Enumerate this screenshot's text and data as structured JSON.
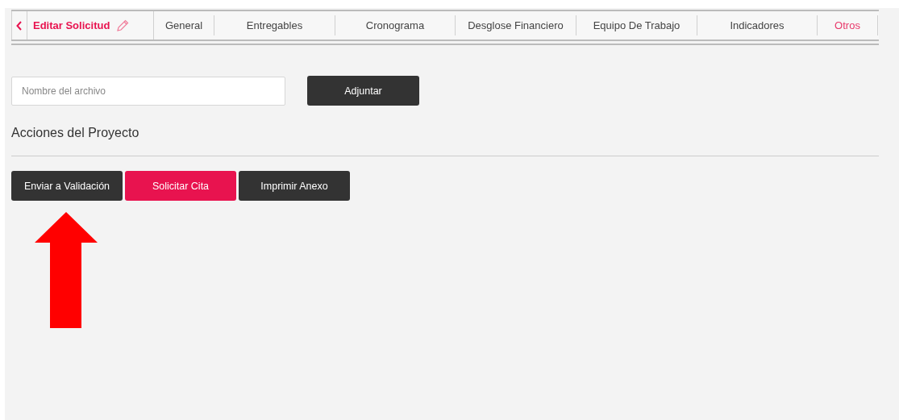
{
  "header": {
    "title": "Editar Solicitud"
  },
  "tabs": [
    {
      "label": "General",
      "selected": false
    },
    {
      "label": "Entregables",
      "selected": false
    },
    {
      "label": "Cronograma",
      "selected": false
    },
    {
      "label": "Desglose Financiero",
      "selected": false
    },
    {
      "label": "Equipo De Trabajo",
      "selected": false
    },
    {
      "label": "Indicadores",
      "selected": false
    },
    {
      "label": "Otros",
      "selected": true
    }
  ],
  "file_field": {
    "placeholder": "Nombre del archivo"
  },
  "attach_button": "Adjuntar",
  "section_title": "Acciones del Proyecto",
  "actions": [
    {
      "label": "Enviar a Validación",
      "kind": "dark"
    },
    {
      "label": "Solicitar Cita",
      "kind": "primary"
    },
    {
      "label": "Imprimir Anexo",
      "kind": "dark"
    }
  ]
}
